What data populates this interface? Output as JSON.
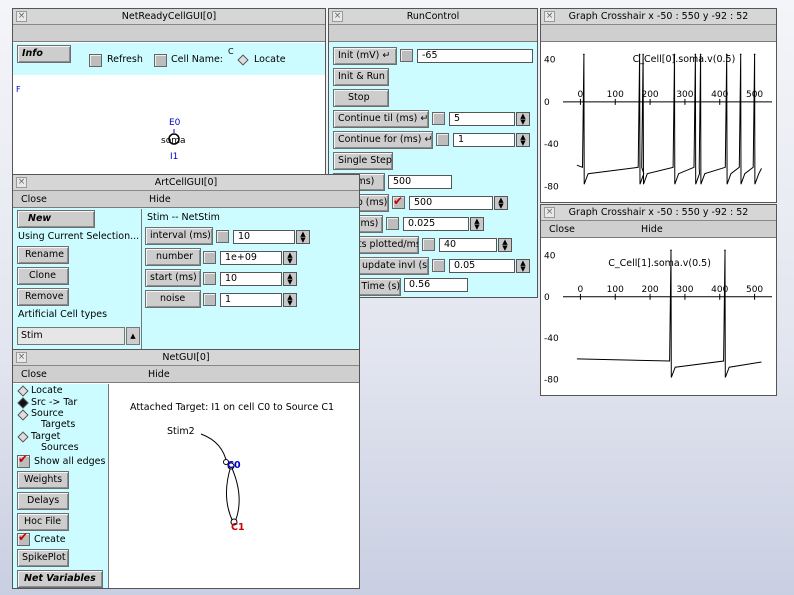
{
  "netready": {
    "title": "NetReadyCellGUI[0]",
    "info_label": "Info",
    "refresh_label": "Refresh",
    "cellname_label": "Cell Name:",
    "cellname_value": "C",
    "locate_label": "Locate",
    "f_label": "F",
    "e0": "E0",
    "soma": "soma",
    "i1": "I1"
  },
  "runcontrol": {
    "title": "RunControl",
    "init_label": "Init (mV)",
    "init_value": "-65",
    "initrun_label": "Init & Run",
    "stop_label": "Stop",
    "continuetil_label": "Continue til (ms)",
    "continuetil_value": "5",
    "continuefor_label": "Continue for (ms)",
    "continuefor_value": "1",
    "singlestep_label": "Single Step",
    "t_label": "t (ms)",
    "t_value": "500",
    "tstop_label": "Tstop (ms)",
    "tstop_value": "500",
    "dt_label": "dt (ms)",
    "dt_value": "0.025",
    "points_label": "Points plotted/ms",
    "points_value": "40",
    "scrn_label": "Scrn update invl (s)",
    "scrn_value": "0.05",
    "realtime_label": "Real Time (s)",
    "realtime_value": "0.56"
  },
  "graph1": {
    "title": "Graph Crosshair x -50 : 550  y -92 : 52",
    "trace": "C_Cell[0].soma.v(0.5)"
  },
  "graph2": {
    "title": "Graph Crosshair x -50 : 550  y -92 : 52",
    "close": "Close",
    "hide": "Hide",
    "trace": "C_Cell[1].soma.v(0.5)"
  },
  "artcell": {
    "title": "ArtCellGUI[0]",
    "close": "Close",
    "hide": "Hide",
    "new_label": "New",
    "using_label": "Using Current Selection...",
    "rename": "Rename",
    "clone": "Clone",
    "remove": "Remove",
    "types_label": "Artificial Cell types",
    "type_item": "Stim",
    "stim_header": "Stim -- NetStim",
    "interval_label": "interval (ms)",
    "interval_value": "10",
    "number_label": "number",
    "number_value": "1e+09",
    "start_label": "start (ms)",
    "start_value": "10",
    "noise_label": "noise",
    "noise_value": "1"
  },
  "netgui": {
    "title": "NetGUI[0]",
    "close": "Close",
    "hide": "Hide",
    "locate": "Locate",
    "src_tar": "Src -> Tar",
    "source": "Source",
    "targets": "Targets",
    "target": "Target",
    "sources": "Sources",
    "show_all": "Show all edges",
    "weights": "Weights",
    "delays": "Delays",
    "hocfile": "Hoc File",
    "create": "Create",
    "spikeplot": "SpikePlot",
    "netvars": "Net Variables",
    "message": "Attached Target: I1 on cell C0 to Source C1",
    "stim2": "Stim2",
    "c0": "C0",
    "c1": "C1"
  },
  "chart_data": [
    {
      "type": "line",
      "xlim": [
        -50,
        550
      ],
      "ylim": [
        -92,
        52
      ],
      "xticks": [
        0,
        100,
        200,
        300,
        400,
        500
      ],
      "yticks": [
        40,
        0,
        -40,
        -80
      ],
      "series": [
        {
          "name": "C_Cell[0].soma.v(0.5)",
          "spikes_at": [
            10,
            170,
            180,
            270,
            330,
            345,
            420,
            460,
            500
          ]
        }
      ]
    },
    {
      "type": "line",
      "xlim": [
        -50,
        550
      ],
      "ylim": [
        -92,
        52
      ],
      "xticks": [
        0,
        100,
        200,
        300,
        400,
        500
      ],
      "yticks": [
        40,
        0,
        -40,
        -80
      ],
      "series": [
        {
          "name": "C_Cell[1].soma.v(0.5)",
          "spikes_at": [
            260,
            415
          ]
        }
      ]
    }
  ]
}
